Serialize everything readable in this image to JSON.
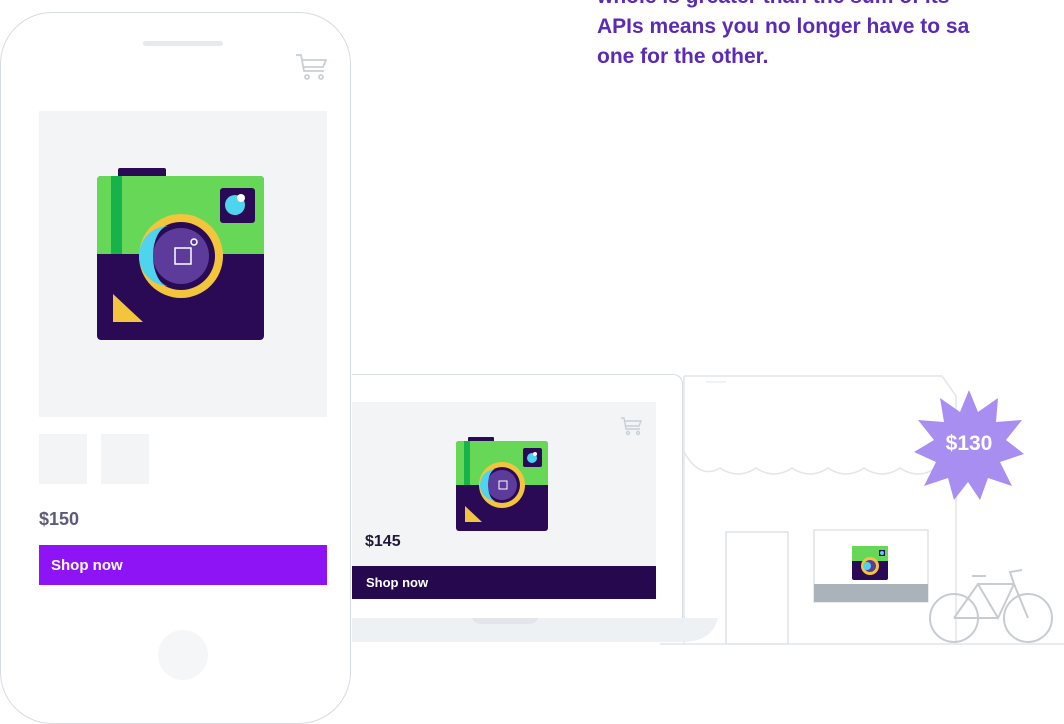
{
  "headline": {
    "line1": "whole is greater than the sum of its",
    "line2": "APIs means you no longer have to sa",
    "line3": "one for the other."
  },
  "phone": {
    "price": "$150",
    "shop_label": "Shop now"
  },
  "laptop": {
    "price": "$145",
    "shop_label": "Shop now"
  },
  "store": {
    "sale_badge": "$130"
  },
  "colors": {
    "headline": "#5b2bb5",
    "phone_button": "#8f14f5",
    "laptop_button": "#25084e",
    "badge": "#a98ef2",
    "camera_green": "#67d758",
    "camera_body": "#2b0a55",
    "camera_lens_ring": "#f2c53d",
    "camera_lens": "#4fd4f0"
  },
  "icons": [
    "cart-icon",
    "camera-icon",
    "bicycle-icon",
    "starburst-badge-icon"
  ]
}
